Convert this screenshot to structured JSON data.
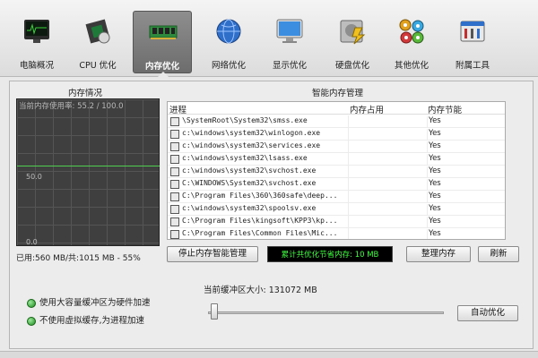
{
  "toolbar": {
    "items": [
      {
        "label": "电脑概况",
        "icon": "monitor-chart-icon",
        "active": false
      },
      {
        "label": "CPU 优化",
        "icon": "cpu-chip-icon",
        "active": false
      },
      {
        "label": "内存优化",
        "icon": "memory-module-icon",
        "active": true
      },
      {
        "label": "网络优化",
        "icon": "globe-icon",
        "active": false
      },
      {
        "label": "显示优化",
        "icon": "display-icon",
        "active": false
      },
      {
        "label": "硬盘优化",
        "icon": "hard-disk-icon",
        "active": false
      },
      {
        "label": "其他优化",
        "icon": "gears-icon",
        "active": false
      },
      {
        "label": "附属工具",
        "icon": "tools-icon",
        "active": false
      }
    ]
  },
  "memory_status": {
    "title": "内存情况",
    "graph_top_label": "当前内存使用率: 55.2 / 100.0",
    "graph_mid_label": "50.0",
    "graph_bottom_label": "0.0",
    "usage_percent": 55.2,
    "usage_text": "已用:560 MB/共:1015 MB - 55%"
  },
  "smart_memory": {
    "title": "智能内存管理",
    "columns": [
      "进程",
      "内存占用",
      "内存节能"
    ],
    "rows": [
      {
        "name": "\\SystemRoot\\System32\\smss.exe",
        "mem": "",
        "save": "Yes"
      },
      {
        "name": "c:\\windows\\system32\\winlogon.exe",
        "mem": "",
        "save": "Yes"
      },
      {
        "name": "c:\\windows\\system32\\services.exe",
        "mem": "",
        "save": "Yes"
      },
      {
        "name": "c:\\windows\\system32\\lsass.exe",
        "mem": "",
        "save": "Yes"
      },
      {
        "name": "c:\\windows\\system32\\svchost.exe",
        "mem": "",
        "save": "Yes"
      },
      {
        "name": "C:\\WINDOWS\\System32\\svchost.exe",
        "mem": "",
        "save": "Yes"
      },
      {
        "name": "C:\\Program Files\\360\\360safe\\deep...",
        "mem": "",
        "save": "Yes"
      },
      {
        "name": "c:\\windows\\system32\\spoolsv.exe",
        "mem": "",
        "save": "Yes"
      },
      {
        "name": "C:\\Program Files\\kingsoft\\KPP3\\kp...",
        "mem": "",
        "save": "Yes"
      },
      {
        "name": "C:\\Program Files\\Common Files\\Mic...",
        "mem": "",
        "save": "Yes"
      }
    ],
    "stop_button": "停止内存智能管理",
    "counter_text": "累计共优化节省内存: 10 MB",
    "clean_button": "整理内存",
    "refresh_button": "刷新"
  },
  "options": {
    "hw_buffer": "使用大容量缓冲区为硬件加速",
    "no_virtual": "不使用虚拟缓存,为进程加速",
    "buffer_label": "当前缓冲区大小:   131072 MB",
    "auto_button": "自动优化",
    "slider_level": 0
  },
  "colors": {
    "graph_line": "#4fce4f",
    "counter_text": "#3cff3c"
  }
}
